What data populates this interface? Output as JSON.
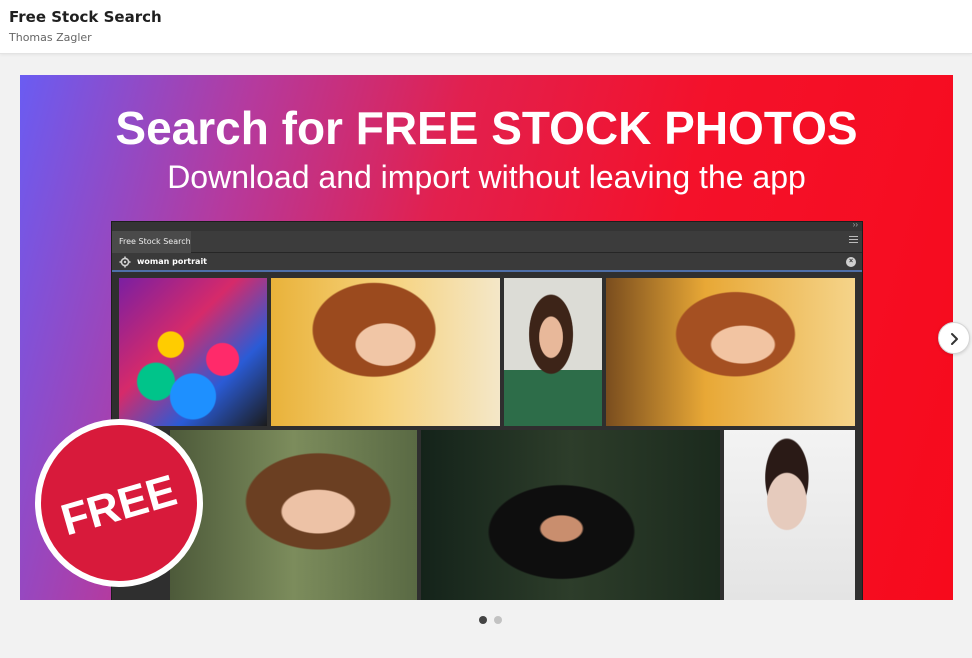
{
  "header": {
    "title": "Free Stock Search",
    "author": "Thomas Zagler"
  },
  "banner": {
    "headline": "Search for FREE STOCK PHOTOS",
    "subline": "Download and import without leaving the app",
    "badge_text": "FREE",
    "colors": {
      "gradient_start": "#6a5cf2",
      "gradient_end": "#f70a1c",
      "badge": "#d81a3b"
    }
  },
  "panel": {
    "tab_label": "Free Stock Search",
    "search_value": "woman portrait",
    "collapse_glyph": "››",
    "thumbnails": [
      "colorful-painted-face",
      "woman-red-hair-golden-light",
      "smiling-curly-hair-woman",
      "woman-eyes-closed-sunlight",
      "woman-freckles-outdoors",
      "woman-black-hijab",
      "woman-dark-lipstick"
    ]
  },
  "carousel": {
    "next_icon": "chevron-right-icon",
    "slide_count": 2,
    "active_slide": 1
  }
}
